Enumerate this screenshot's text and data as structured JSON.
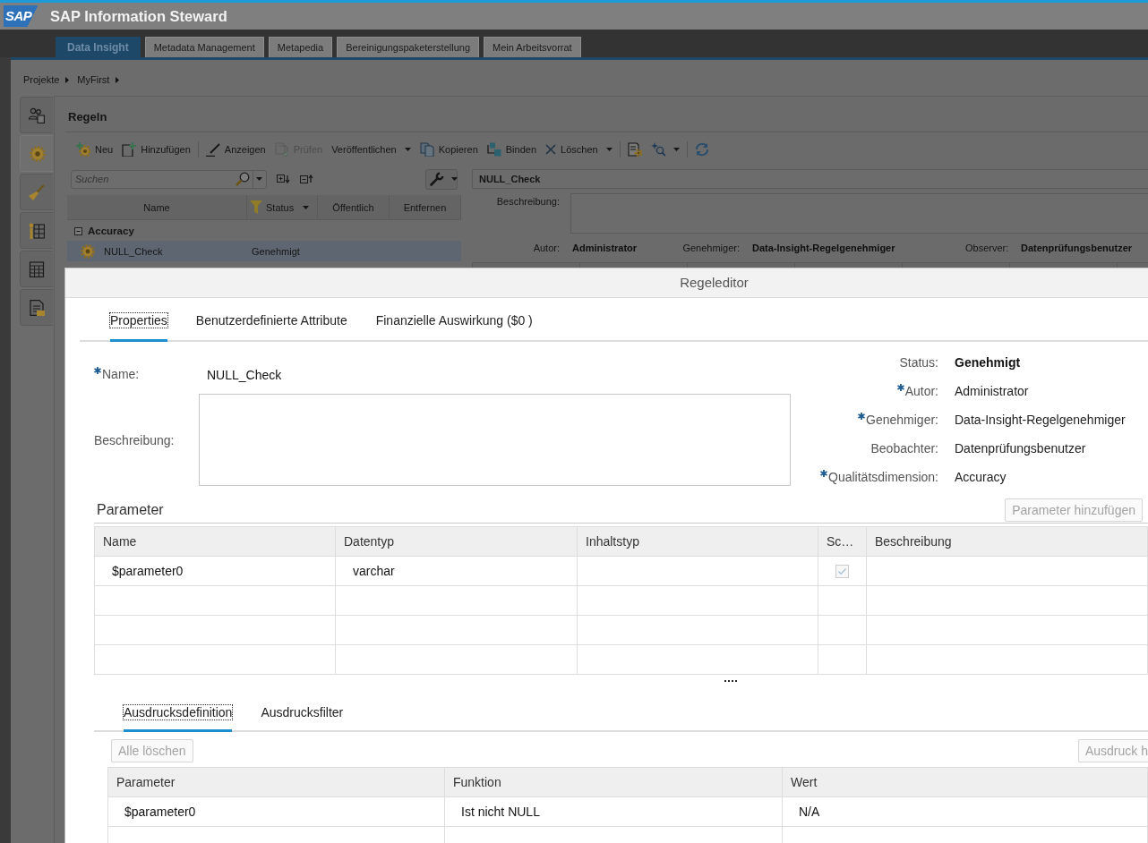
{
  "header": {
    "logo": "SAP",
    "title": "SAP Information Steward"
  },
  "main_tabs": [
    {
      "label": "Data Insight",
      "selected": true
    },
    {
      "label": "Metadata Management",
      "selected": false
    },
    {
      "label": "Metapedia",
      "selected": false
    },
    {
      "label": "Bereinigungspaketerstellung",
      "selected": false
    },
    {
      "label": "Mein Arbeitsvorrat",
      "selected": false
    }
  ],
  "breadcrumb": [
    "Projekte",
    "MyFirst"
  ],
  "side_tabs": [
    {
      "selected": false
    },
    {
      "selected": true
    },
    {
      "selected": false
    },
    {
      "selected": false
    },
    {
      "selected": false
    },
    {
      "selected": false
    }
  ],
  "rules_panel": {
    "title": "Regeln",
    "toolbar": [
      {
        "kind": "button",
        "label": "Neu",
        "disabled": false,
        "dropdown": false
      },
      {
        "kind": "button",
        "label": "Hinzufügen",
        "disabled": false,
        "dropdown": false
      },
      {
        "kind": "separator"
      },
      {
        "kind": "button",
        "label": "Anzeigen",
        "disabled": false,
        "dropdown": false
      },
      {
        "kind": "button",
        "label": "Prüfen",
        "disabled": true,
        "dropdown": false
      },
      {
        "kind": "button",
        "label": "Veröffentlichen",
        "disabled": false,
        "dropdown": true
      },
      {
        "kind": "button",
        "label": "Kopieren",
        "disabled": false,
        "dropdown": false
      },
      {
        "kind": "button",
        "label": "Binden",
        "disabled": false,
        "dropdown": false
      },
      {
        "kind": "button",
        "label": "Löschen",
        "disabled": false,
        "dropdown": true
      },
      {
        "kind": "separator"
      },
      {
        "kind": "icon_button",
        "disabled": false,
        "dropdown": false
      },
      {
        "kind": "icon_button",
        "disabled": false,
        "dropdown": true
      },
      {
        "kind": "separator"
      },
      {
        "kind": "icon_button",
        "disabled": false,
        "dropdown": false
      }
    ],
    "search": {
      "placeholder": "Suchen"
    },
    "table": {
      "columns": [
        {
          "label": "Name",
          "filtered": false
        },
        {
          "label": "Status",
          "filtered": true
        },
        {
          "label": "Öffentlich",
          "filtered": false
        },
        {
          "label": "Entfernen",
          "filtered": false
        }
      ],
      "groups": [
        {
          "label": "Accuracy",
          "expanded": true,
          "rows": [
            {
              "name": "NULL_Check",
              "status": "Genehmigt",
              "selected": true
            }
          ]
        }
      ]
    }
  },
  "rule_detail": {
    "name": "NULL_Check",
    "description_label": "Beschreibung:",
    "meta": [
      {
        "label": "Autor:",
        "value": "Administrator"
      },
      {
        "label": "Genehmiger:",
        "value": "Data-Insight-Regelgenehmiger"
      },
      {
        "label": "Observer:",
        "value": "Datenprüfungsbenutzer"
      }
    ]
  },
  "dialog": {
    "title": "Regeleditor",
    "tabs": [
      {
        "label": "Properties",
        "selected": true
      },
      {
        "label": "Benutzerdefinierte Attribute",
        "selected": false
      },
      {
        "label": "Finanzielle Auswirkung ($0 )",
        "selected": false
      }
    ],
    "name_field": {
      "label": "Name:",
      "required": true,
      "value": "NULL_Check"
    },
    "description_field": {
      "label": "Beschreibung:",
      "required": false
    },
    "properties": [
      {
        "kind": "status",
        "label": "Status:",
        "required": false,
        "value": "Genehmigt"
      },
      {
        "kind": "text",
        "label": "Autor:",
        "required": true,
        "value": "Administrator"
      },
      {
        "kind": "text",
        "label": "Genehmiger:",
        "required": true,
        "value": "Data-Insight-Regelgenehmiger"
      },
      {
        "kind": "text",
        "label": "Beobachter:",
        "required": false,
        "value": "Datenprüfungsbenutzer"
      },
      {
        "kind": "text",
        "label": "Qualitätsdimension:",
        "required": true,
        "value": "Accuracy"
      }
    ],
    "parameters": {
      "title": "Parameter",
      "add_button": {
        "label": "Parameter hinzufügen",
        "disabled": true
      },
      "columns": [
        "Name",
        "Datentyp",
        "Inhaltstyp",
        "Sc…",
        "Beschreibung"
      ],
      "rows": [
        {
          "kind": "data",
          "name": "$parameter0",
          "data_type": "varchar",
          "checked": true,
          "disabled": true
        },
        {
          "kind": "blank"
        },
        {
          "kind": "blank"
        },
        {
          "kind": "blank"
        }
      ]
    },
    "expression_tabs": [
      {
        "label": "Ausdrucksdefinition",
        "selected": true
      },
      {
        "label": "Ausdrucksfilter",
        "selected": false
      }
    ],
    "expression_buttons": [
      {
        "label": "Alle löschen",
        "disabled": true
      },
      {
        "label": "Ausdruck h",
        "disabled": true
      }
    ],
    "expression_table": {
      "columns": [
        "Parameter",
        "Funktion",
        "Wert"
      ],
      "rows": [
        {
          "kind": "data",
          "cells": [
            "$parameter0",
            "Ist nicht NULL",
            "N/A"
          ]
        },
        {
          "kind": "blank"
        }
      ]
    }
  }
}
